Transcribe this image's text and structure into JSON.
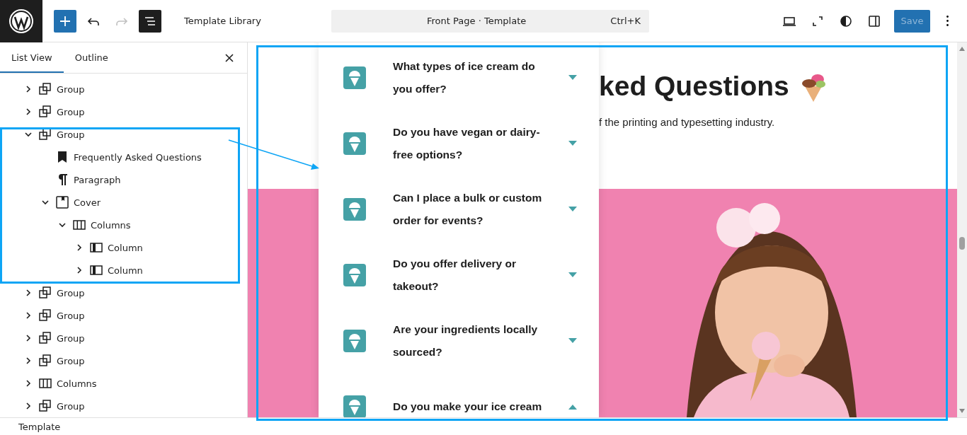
{
  "top_bar": {
    "undo": {
      "disabled": false
    },
    "redo": {
      "disabled": true
    },
    "list_view_toggle": {
      "on": true
    },
    "title": "Template Library",
    "command_bar": {
      "label": "Front Page · Template",
      "shortcut": "Ctrl+K"
    },
    "save_button": {
      "label": "Save",
      "disabled": true
    }
  },
  "sidebar": {
    "tabs": [
      {
        "label": "List View",
        "selected": true
      },
      {
        "label": "Outline",
        "selected": false
      }
    ],
    "tree": [
      {
        "kind": "group",
        "label": "Group",
        "expanded": false
      },
      {
        "kind": "group",
        "label": "Group",
        "expanded": false
      },
      {
        "kind": "group",
        "label": "Group",
        "expanded": true,
        "children": [
          {
            "kind": "heading",
            "label": "Frequently Asked Questions"
          },
          {
            "kind": "paragraph",
            "label": "Paragraph"
          },
          {
            "kind": "cover",
            "label": "Cover",
            "expanded": true,
            "children": [
              {
                "kind": "columns",
                "label": "Columns",
                "expanded": true,
                "children": [
                  {
                    "kind": "column",
                    "label": "Column",
                    "expanded": false
                  },
                  {
                    "kind": "column",
                    "label": "Column",
                    "expanded": false
                  }
                ]
              }
            ]
          }
        ]
      },
      {
        "kind": "group",
        "label": "Group",
        "expanded": false
      },
      {
        "kind": "group",
        "label": "Group",
        "expanded": false
      },
      {
        "kind": "group",
        "label": "Group",
        "expanded": false
      },
      {
        "kind": "group",
        "label": "Group",
        "expanded": false
      },
      {
        "kind": "columns",
        "label": "Columns",
        "expanded": false
      },
      {
        "kind": "group",
        "label": "Group",
        "expanded": false
      }
    ]
  },
  "canvas": {
    "heading": "ked Questions",
    "paragraph": "f the printing and typesetting industry.",
    "faq": [
      {
        "question": "What types of ice cream do you offer?",
        "expanded": false
      },
      {
        "question": "Do you have vegan or dairy-free options?",
        "expanded": false
      },
      {
        "question": "Can I place a bulk or custom order for events?",
        "expanded": false
      },
      {
        "question": "Do you offer delivery or takeout?",
        "expanded": false
      },
      {
        "question": "Are your ingredients locally sourced?",
        "expanded": false
      },
      {
        "question": "Do you make your ice cream",
        "expanded": true
      }
    ]
  },
  "footer": {
    "breadcrumb": "Template"
  }
}
